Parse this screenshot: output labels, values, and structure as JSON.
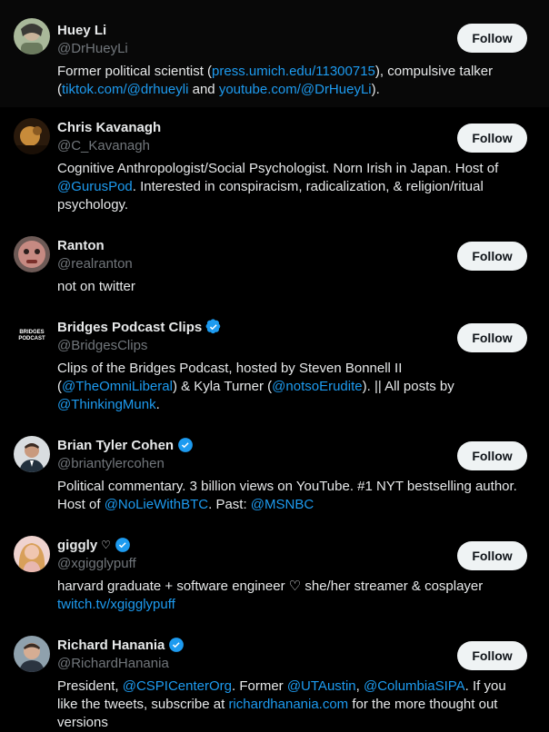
{
  "follow_label": "Follow",
  "users": [
    {
      "name": "Huey Li",
      "handle": "@DrHueyLi",
      "bio": [
        {
          "t": "Former political scientist ("
        },
        {
          "t": "press.umich.edu/11300715",
          "link": true
        },
        {
          "t": "), compulsive talker ("
        },
        {
          "t": "tiktok.com/@drhueyli",
          "link": true
        },
        {
          "t": " and "
        },
        {
          "t": "youtube.com/@DrHueyLi",
          "link": true
        },
        {
          "t": ")."
        }
      ]
    },
    {
      "name": "Chris Kavanagh",
      "handle": "@C_Kavanagh",
      "bio": [
        {
          "t": "Cognitive Anthropologist/Social Psychologist. Norn Irish in Japan. Host of "
        },
        {
          "t": "@GurusPod",
          "link": true
        },
        {
          "t": ". Interested in conspiracism, radicalization, & religion/ritual psychology."
        }
      ]
    },
    {
      "name": "Ranton",
      "handle": "@realranton",
      "bio": [
        {
          "t": "not on twitter"
        }
      ]
    },
    {
      "name": "Bridges Podcast Clips",
      "handle": "@BridgesClips",
      "avatar_text": "BRIDGES PODCAST",
      "bio": [
        {
          "t": "Clips of the Bridges Podcast, hosted by Steven Bonnell II ("
        },
        {
          "t": "@TheOmniLiberal",
          "link": true
        },
        {
          "t": ") & Kyla Turner ("
        },
        {
          "t": "@notsoErudite",
          "link": true
        },
        {
          "t": "). || All posts by "
        },
        {
          "t": "@ThinkingMunk",
          "link": true
        },
        {
          "t": "."
        }
      ]
    },
    {
      "name": "Brian Tyler Cohen",
      "handle": "@briantylercohen",
      "bio": [
        {
          "t": "Political commentary. 3 billion views on YouTube. #1 NYT bestselling author. Host of "
        },
        {
          "t": "@NoLieWithBTC",
          "link": true
        },
        {
          "t": ". Past: "
        },
        {
          "t": "@MSNBC",
          "link": true
        }
      ]
    },
    {
      "name": "giggly",
      "name_suffix": "♡",
      "handle": "@xgigglypuff",
      "bio": [
        {
          "t": "harvard graduate + software engineer ♡ she/her streamer & cosplayer "
        },
        {
          "t": "twitch.tv/xgigglypuff",
          "link": true
        }
      ]
    },
    {
      "name": "Richard Hanania",
      "handle": "@RichardHanania",
      "bio": [
        {
          "t": "President, "
        },
        {
          "t": "@CSPICenterOrg",
          "link": true
        },
        {
          "t": ". Former "
        },
        {
          "t": "@UTAustin",
          "link": true
        },
        {
          "t": ", "
        },
        {
          "t": "@ColumbiaSIPA",
          "link": true
        },
        {
          "t": ". If you like the tweets, subscribe at "
        },
        {
          "t": "richardhanania.com",
          "link": true
        },
        {
          "t": " for the more thought out versions"
        }
      ]
    }
  ]
}
